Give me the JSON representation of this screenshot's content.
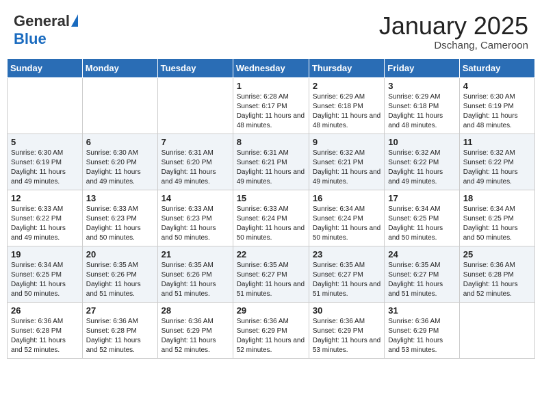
{
  "header": {
    "logo_general": "General",
    "logo_blue": "Blue",
    "month_title": "January 2025",
    "location": "Dschang, Cameroon"
  },
  "weekdays": [
    "Sunday",
    "Monday",
    "Tuesday",
    "Wednesday",
    "Thursday",
    "Friday",
    "Saturday"
  ],
  "weeks": [
    [
      {
        "day": "",
        "sunrise": "",
        "sunset": "",
        "daylight": ""
      },
      {
        "day": "",
        "sunrise": "",
        "sunset": "",
        "daylight": ""
      },
      {
        "day": "",
        "sunrise": "",
        "sunset": "",
        "daylight": ""
      },
      {
        "day": "1",
        "sunrise": "Sunrise: 6:28 AM",
        "sunset": "Sunset: 6:17 PM",
        "daylight": "Daylight: 11 hours and 48 minutes."
      },
      {
        "day": "2",
        "sunrise": "Sunrise: 6:29 AM",
        "sunset": "Sunset: 6:18 PM",
        "daylight": "Daylight: 11 hours and 48 minutes."
      },
      {
        "day": "3",
        "sunrise": "Sunrise: 6:29 AM",
        "sunset": "Sunset: 6:18 PM",
        "daylight": "Daylight: 11 hours and 48 minutes."
      },
      {
        "day": "4",
        "sunrise": "Sunrise: 6:30 AM",
        "sunset": "Sunset: 6:19 PM",
        "daylight": "Daylight: 11 hours and 48 minutes."
      }
    ],
    [
      {
        "day": "5",
        "sunrise": "Sunrise: 6:30 AM",
        "sunset": "Sunset: 6:19 PM",
        "daylight": "Daylight: 11 hours and 49 minutes."
      },
      {
        "day": "6",
        "sunrise": "Sunrise: 6:30 AM",
        "sunset": "Sunset: 6:20 PM",
        "daylight": "Daylight: 11 hours and 49 minutes."
      },
      {
        "day": "7",
        "sunrise": "Sunrise: 6:31 AM",
        "sunset": "Sunset: 6:20 PM",
        "daylight": "Daylight: 11 hours and 49 minutes."
      },
      {
        "day": "8",
        "sunrise": "Sunrise: 6:31 AM",
        "sunset": "Sunset: 6:21 PM",
        "daylight": "Daylight: 11 hours and 49 minutes."
      },
      {
        "day": "9",
        "sunrise": "Sunrise: 6:32 AM",
        "sunset": "Sunset: 6:21 PM",
        "daylight": "Daylight: 11 hours and 49 minutes."
      },
      {
        "day": "10",
        "sunrise": "Sunrise: 6:32 AM",
        "sunset": "Sunset: 6:22 PM",
        "daylight": "Daylight: 11 hours and 49 minutes."
      },
      {
        "day": "11",
        "sunrise": "Sunrise: 6:32 AM",
        "sunset": "Sunset: 6:22 PM",
        "daylight": "Daylight: 11 hours and 49 minutes."
      }
    ],
    [
      {
        "day": "12",
        "sunrise": "Sunrise: 6:33 AM",
        "sunset": "Sunset: 6:22 PM",
        "daylight": "Daylight: 11 hours and 49 minutes."
      },
      {
        "day": "13",
        "sunrise": "Sunrise: 6:33 AM",
        "sunset": "Sunset: 6:23 PM",
        "daylight": "Daylight: 11 hours and 50 minutes."
      },
      {
        "day": "14",
        "sunrise": "Sunrise: 6:33 AM",
        "sunset": "Sunset: 6:23 PM",
        "daylight": "Daylight: 11 hours and 50 minutes."
      },
      {
        "day": "15",
        "sunrise": "Sunrise: 6:33 AM",
        "sunset": "Sunset: 6:24 PM",
        "daylight": "Daylight: 11 hours and 50 minutes."
      },
      {
        "day": "16",
        "sunrise": "Sunrise: 6:34 AM",
        "sunset": "Sunset: 6:24 PM",
        "daylight": "Daylight: 11 hours and 50 minutes."
      },
      {
        "day": "17",
        "sunrise": "Sunrise: 6:34 AM",
        "sunset": "Sunset: 6:25 PM",
        "daylight": "Daylight: 11 hours and 50 minutes."
      },
      {
        "day": "18",
        "sunrise": "Sunrise: 6:34 AM",
        "sunset": "Sunset: 6:25 PM",
        "daylight": "Daylight: 11 hours and 50 minutes."
      }
    ],
    [
      {
        "day": "19",
        "sunrise": "Sunrise: 6:34 AM",
        "sunset": "Sunset: 6:25 PM",
        "daylight": "Daylight: 11 hours and 50 minutes."
      },
      {
        "day": "20",
        "sunrise": "Sunrise: 6:35 AM",
        "sunset": "Sunset: 6:26 PM",
        "daylight": "Daylight: 11 hours and 51 minutes."
      },
      {
        "day": "21",
        "sunrise": "Sunrise: 6:35 AM",
        "sunset": "Sunset: 6:26 PM",
        "daylight": "Daylight: 11 hours and 51 minutes."
      },
      {
        "day": "22",
        "sunrise": "Sunrise: 6:35 AM",
        "sunset": "Sunset: 6:27 PM",
        "daylight": "Daylight: 11 hours and 51 minutes."
      },
      {
        "day": "23",
        "sunrise": "Sunrise: 6:35 AM",
        "sunset": "Sunset: 6:27 PM",
        "daylight": "Daylight: 11 hours and 51 minutes."
      },
      {
        "day": "24",
        "sunrise": "Sunrise: 6:35 AM",
        "sunset": "Sunset: 6:27 PM",
        "daylight": "Daylight: 11 hours and 51 minutes."
      },
      {
        "day": "25",
        "sunrise": "Sunrise: 6:36 AM",
        "sunset": "Sunset: 6:28 PM",
        "daylight": "Daylight: 11 hours and 52 minutes."
      }
    ],
    [
      {
        "day": "26",
        "sunrise": "Sunrise: 6:36 AM",
        "sunset": "Sunset: 6:28 PM",
        "daylight": "Daylight: 11 hours and 52 minutes."
      },
      {
        "day": "27",
        "sunrise": "Sunrise: 6:36 AM",
        "sunset": "Sunset: 6:28 PM",
        "daylight": "Daylight: 11 hours and 52 minutes."
      },
      {
        "day": "28",
        "sunrise": "Sunrise: 6:36 AM",
        "sunset": "Sunset: 6:29 PM",
        "daylight": "Daylight: 11 hours and 52 minutes."
      },
      {
        "day": "29",
        "sunrise": "Sunrise: 6:36 AM",
        "sunset": "Sunset: 6:29 PM",
        "daylight": "Daylight: 11 hours and 52 minutes."
      },
      {
        "day": "30",
        "sunrise": "Sunrise: 6:36 AM",
        "sunset": "Sunset: 6:29 PM",
        "daylight": "Daylight: 11 hours and 53 minutes."
      },
      {
        "day": "31",
        "sunrise": "Sunrise: 6:36 AM",
        "sunset": "Sunset: 6:29 PM",
        "daylight": "Daylight: 11 hours and 53 minutes."
      },
      {
        "day": "",
        "sunrise": "",
        "sunset": "",
        "daylight": ""
      }
    ]
  ]
}
